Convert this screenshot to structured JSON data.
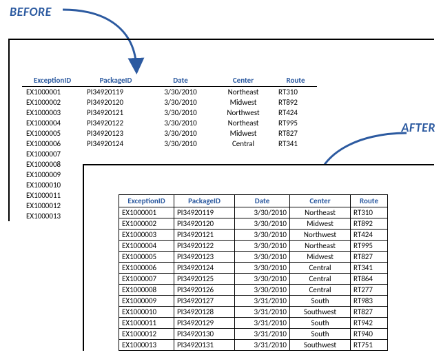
{
  "labels": {
    "before": "BEFORE",
    "after": "AFTER"
  },
  "columns": {
    "exception": "ExceptionID",
    "package": "PackageID",
    "date": "Date",
    "center": "Center",
    "route": "Route"
  },
  "before_rows": [
    {
      "ex": "EX1000001",
      "pkg": "PI34920119",
      "date": "3/30/2010",
      "center": "Northeast",
      "route": "RT310"
    },
    {
      "ex": "EX1000002",
      "pkg": "PI34920120",
      "date": "3/30/2010",
      "center": "Midwest",
      "route": "RT892"
    },
    {
      "ex": "EX1000003",
      "pkg": "PI34920121",
      "date": "3/30/2010",
      "center": "Northwest",
      "route": "RT424"
    },
    {
      "ex": "EX1000004",
      "pkg": "PI34920122",
      "date": "3/30/2010",
      "center": "Northeast",
      "route": "RT995"
    },
    {
      "ex": "EX1000005",
      "pkg": "PI34920123",
      "date": "3/30/2010",
      "center": "Midwest",
      "route": "RT827"
    },
    {
      "ex": "EX1000006",
      "pkg": "PI34920124",
      "date": "3/30/2010",
      "center": "Central",
      "route": "RT341"
    },
    {
      "ex": "EX1000007",
      "pkg": "",
      "date": "",
      "center": "",
      "route": ""
    },
    {
      "ex": "EX1000008",
      "pkg": "",
      "date": "",
      "center": "",
      "route": ""
    },
    {
      "ex": "EX1000009",
      "pkg": "",
      "date": "",
      "center": "",
      "route": ""
    },
    {
      "ex": "EX1000010",
      "pkg": "",
      "date": "",
      "center": "",
      "route": ""
    },
    {
      "ex": "EX1000011",
      "pkg": "",
      "date": "",
      "center": "",
      "route": ""
    },
    {
      "ex": "EX1000012",
      "pkg": "",
      "date": "",
      "center": "",
      "route": ""
    },
    {
      "ex": "EX1000013",
      "pkg": "",
      "date": "",
      "center": "",
      "route": ""
    }
  ],
  "after_rows": [
    {
      "ex": "EX1000001",
      "pkg": "PI34920119",
      "date": "3/30/2010",
      "center": "Northeast",
      "route": "RT310"
    },
    {
      "ex": "EX1000002",
      "pkg": "PI34920120",
      "date": "3/30/2010",
      "center": "Midwest",
      "route": "RT892"
    },
    {
      "ex": "EX1000003",
      "pkg": "PI34920121",
      "date": "3/30/2010",
      "center": "Northwest",
      "route": "RT424"
    },
    {
      "ex": "EX1000004",
      "pkg": "PI34920122",
      "date": "3/30/2010",
      "center": "Northeast",
      "route": "RT995"
    },
    {
      "ex": "EX1000005",
      "pkg": "PI34920123",
      "date": "3/30/2010",
      "center": "Midwest",
      "route": "RT827"
    },
    {
      "ex": "EX1000006",
      "pkg": "PI34920124",
      "date": "3/30/2010",
      "center": "Central",
      "route": "RT341"
    },
    {
      "ex": "EX1000007",
      "pkg": "PI34920125",
      "date": "3/30/2010",
      "center": "Central",
      "route": "RT864"
    },
    {
      "ex": "EX1000008",
      "pkg": "PI34920126",
      "date": "3/30/2010",
      "center": "Central",
      "route": "RT277"
    },
    {
      "ex": "EX1000009",
      "pkg": "PI34920127",
      "date": "3/31/2010",
      "center": "South",
      "route": "RT983"
    },
    {
      "ex": "EX1000010",
      "pkg": "PI34920128",
      "date": "3/31/2010",
      "center": "Southwest",
      "route": "RT827"
    },
    {
      "ex": "EX1000011",
      "pkg": "PI34920129",
      "date": "3/31/2010",
      "center": "South",
      "route": "RT942"
    },
    {
      "ex": "EX1000012",
      "pkg": "PI34920130",
      "date": "3/31/2010",
      "center": "South",
      "route": "RT940"
    },
    {
      "ex": "EX1000013",
      "pkg": "PI34920131",
      "date": "3/31/2010",
      "center": "Southwest",
      "route": "RT751"
    }
  ]
}
